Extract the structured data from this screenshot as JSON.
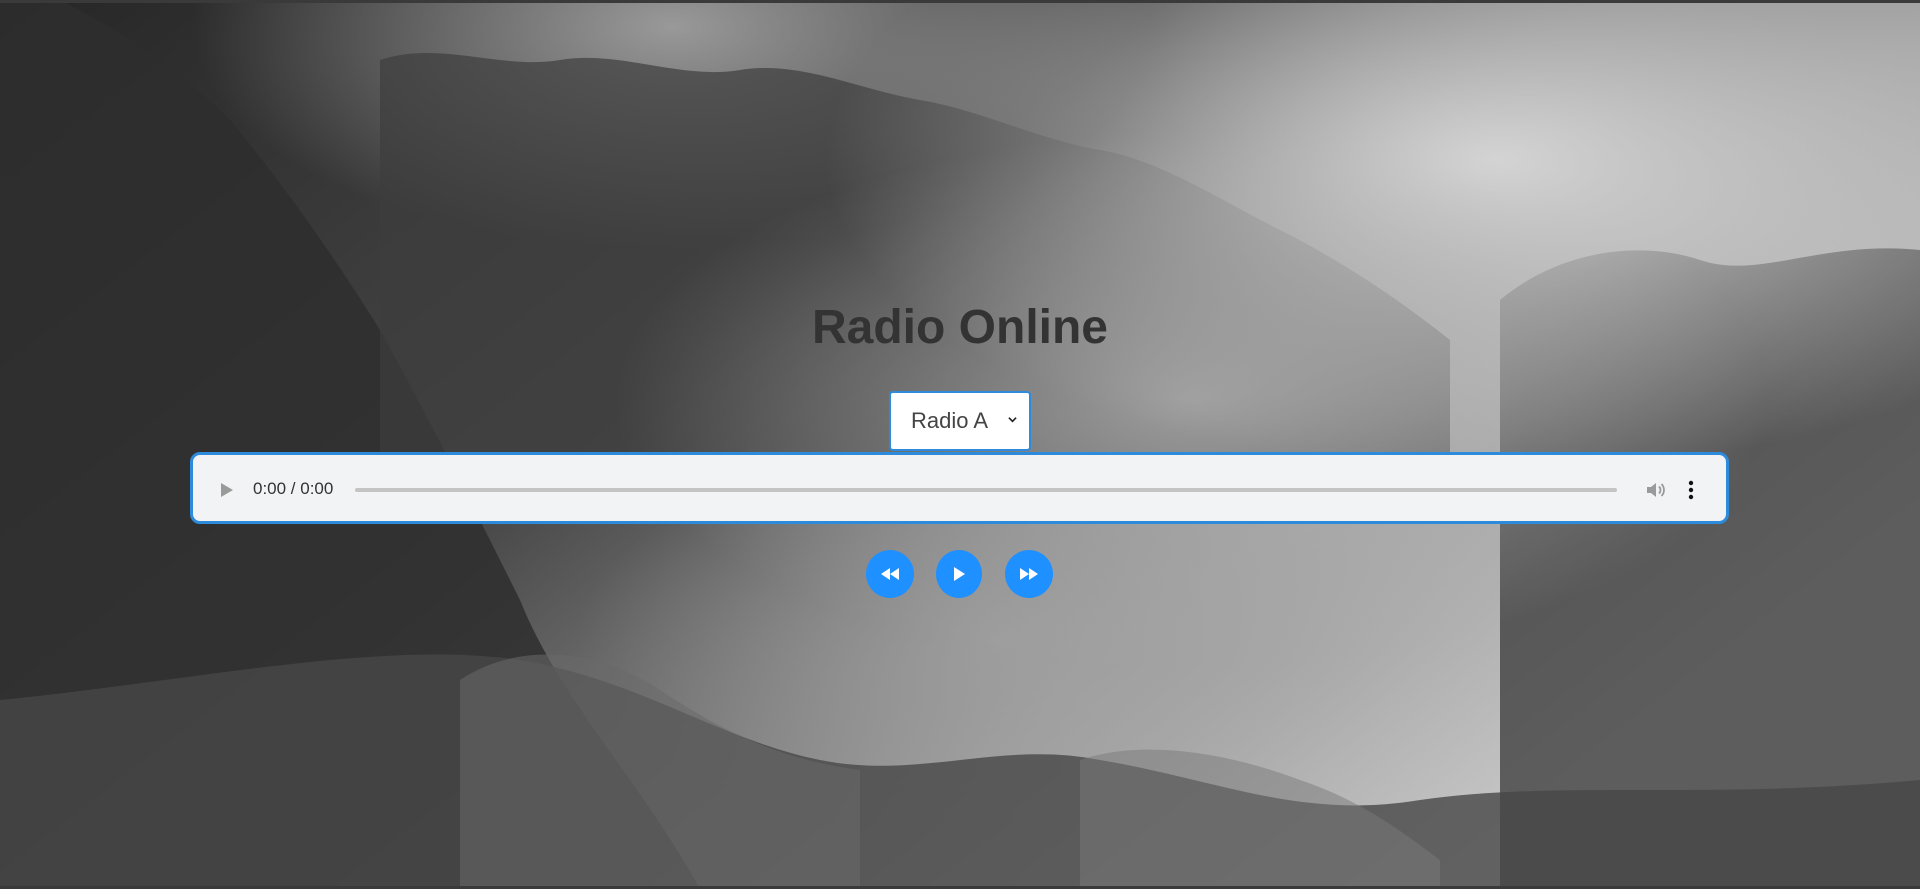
{
  "app": {
    "title": "Radio Online"
  },
  "station": {
    "selected": "Radio A"
  },
  "player": {
    "time": "0:00 / 0:00",
    "progress": 0
  },
  "controls": {
    "accent": "#1e90ff",
    "buttons": [
      {
        "icon": "rewind-icon"
      },
      {
        "icon": "play-icon"
      },
      {
        "icon": "fast-forward-icon"
      }
    ]
  },
  "colors": {
    "title": "#333333",
    "player_border": "#2e8bdb",
    "player_bg": "#f1f3f4"
  }
}
